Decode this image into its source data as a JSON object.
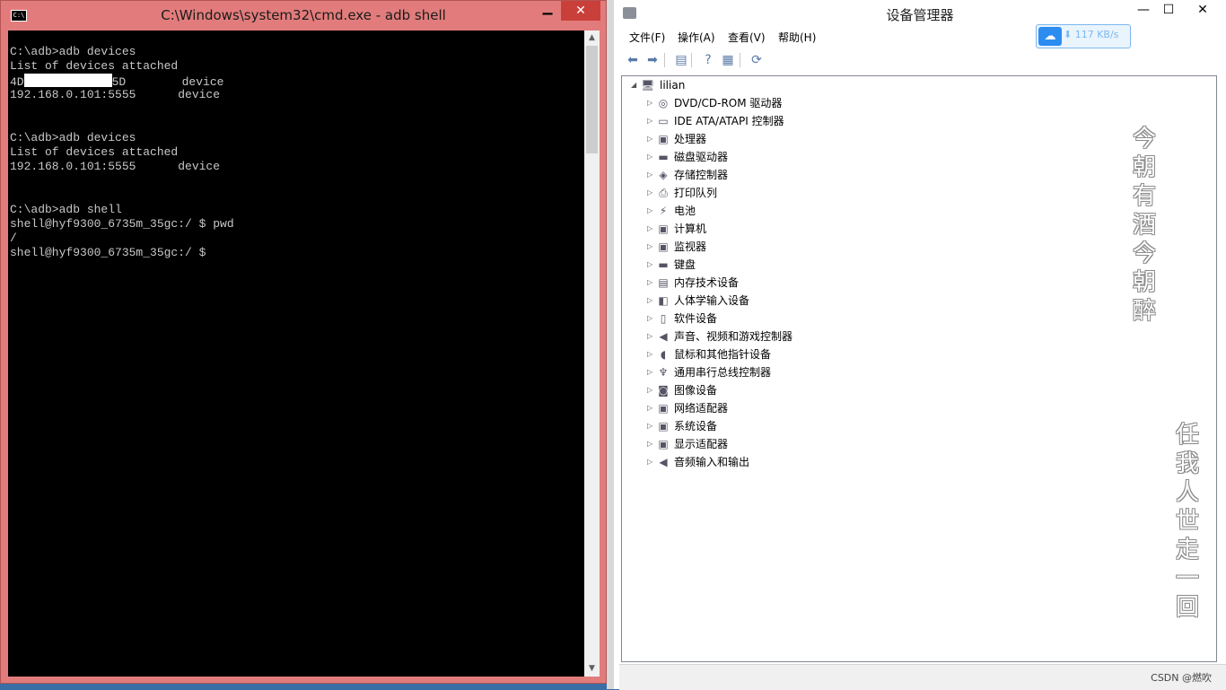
{
  "cmd": {
    "title": "C:\\Windows\\system32\\cmd.exe - adb  shell",
    "icon_text": "C:\\",
    "minimize_glyph": "▁",
    "close_glyph": "✕",
    "lines": [
      "",
      "C:\\adb>adb devices",
      "List of devices attached",
      "__REDACTED__",
      "192.168.0.101:5555      device",
      "",
      "",
      "C:\\adb>adb devices",
      "List of devices attached",
      "192.168.0.101:5555      device",
      "",
      "",
      "C:\\adb>adb shell",
      "shell@hyf9300_6735m_35gc:/ $ pwd",
      "/",
      "shell@hyf9300_6735m_35gc:/ $"
    ],
    "redacted_line": {
      "prefix": "4D",
      "suffix": "5D",
      "tail": "        device"
    },
    "scroll_up": "▲",
    "scroll_down": "▼"
  },
  "devmgr": {
    "title": "设备管理器",
    "minimize_glyph": "—",
    "maximize_glyph": "☐",
    "close_glyph": "✕",
    "menu": [
      "文件(F)",
      "操作(A)",
      "查看(V)",
      "帮助(H)"
    ],
    "speed_label": "⬇ 117 KB/s",
    "toolbar": [
      {
        "name": "back-icon",
        "glyph": "⬅"
      },
      {
        "name": "forward-icon",
        "glyph": "➡"
      },
      {
        "name": "properties-icon",
        "glyph": "▤"
      },
      {
        "name": "help-icon",
        "glyph": "?"
      },
      {
        "name": "view-icon",
        "glyph": "▦"
      },
      {
        "name": "scan-hardware-icon",
        "glyph": "⟳"
      }
    ],
    "root": {
      "label": "lilian",
      "expander": "◢",
      "icon": "computer-icon"
    },
    "categories": [
      {
        "label": "DVD/CD-ROM 驱动器",
        "icon": "dvd-icon",
        "glyph": "◎"
      },
      {
        "label": "IDE ATA/ATAPI 控制器",
        "icon": "ide-controller-icon",
        "glyph": "▭"
      },
      {
        "label": "处理器",
        "icon": "processor-icon",
        "glyph": "▣"
      },
      {
        "label": "磁盘驱动器",
        "icon": "disk-icon",
        "glyph": "▬"
      },
      {
        "label": "存储控制器",
        "icon": "storage-controller-icon",
        "glyph": "◈"
      },
      {
        "label": "打印队列",
        "icon": "printer-icon",
        "glyph": "⎙"
      },
      {
        "label": "电池",
        "icon": "battery-icon",
        "glyph": "⚡"
      },
      {
        "label": "计算机",
        "icon": "computer-icon",
        "glyph": "▣"
      },
      {
        "label": "监视器",
        "icon": "monitor-icon",
        "glyph": "▣"
      },
      {
        "label": "键盘",
        "icon": "keyboard-icon",
        "glyph": "▬"
      },
      {
        "label": "内存技术设备",
        "icon": "memory-device-icon",
        "glyph": "▤"
      },
      {
        "label": "人体学输入设备",
        "icon": "hid-icon",
        "glyph": "◧"
      },
      {
        "label": "软件设备",
        "icon": "software-device-icon",
        "glyph": "▯"
      },
      {
        "label": "声音、视频和游戏控制器",
        "icon": "speaker-icon",
        "glyph": "◀"
      },
      {
        "label": "鼠标和其他指针设备",
        "icon": "mouse-icon",
        "glyph": "◖"
      },
      {
        "label": "通用串行总线控制器",
        "icon": "usb-icon",
        "glyph": "♆"
      },
      {
        "label": "图像设备",
        "icon": "camera-icon",
        "glyph": "◙"
      },
      {
        "label": "网络适配器",
        "icon": "network-adapter-icon",
        "glyph": "▣"
      },
      {
        "label": "系统设备",
        "icon": "system-device-icon",
        "glyph": "▣"
      },
      {
        "label": "显示适配器",
        "icon": "display-adapter-icon",
        "glyph": "▣"
      },
      {
        "label": "音频输入和输出",
        "icon": "audio-io-icon",
        "glyph": "◀"
      }
    ],
    "expander_glyph": "▷",
    "calligraphy_1": [
      "今",
      "朝",
      "有",
      "酒",
      "今",
      "朝",
      "醉"
    ],
    "calligraphy_2": [
      "任",
      "我",
      "人",
      "世",
      "走",
      "一",
      "回"
    ],
    "watermark": "CSDN @燃吹"
  }
}
